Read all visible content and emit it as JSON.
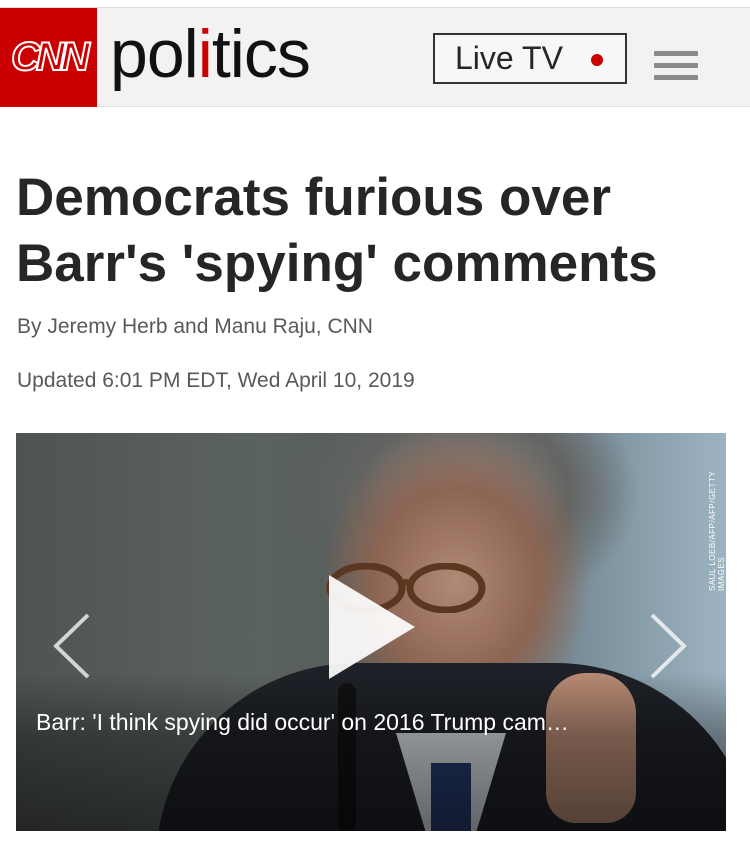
{
  "header": {
    "logo_text": "CNN",
    "section_pre": "pol",
    "section_i": "i",
    "section_mid": "t",
    "section_i2": "i",
    "section_post": "cs",
    "live_label": "Live TV",
    "brand_color": "#cc0000",
    "menu_icon": "hamburger-menu-icon"
  },
  "article": {
    "headline": "Democrats furious over Barr's 'spying' comments",
    "byline": "By Jeremy Herb and Manu Raju, CNN",
    "updated": "Updated 6:01 PM EDT, Wed April 10, 2019"
  },
  "media": {
    "caption": "Barr: 'I think spying did occur' on 2016 Trump cam…",
    "photo_credit": "SAUL LOEB/AFP/AFP/GETTY IMAGES",
    "play_icon": "play-icon",
    "prev_icon": "chevron-left-icon",
    "next_icon": "chevron-right-icon"
  }
}
